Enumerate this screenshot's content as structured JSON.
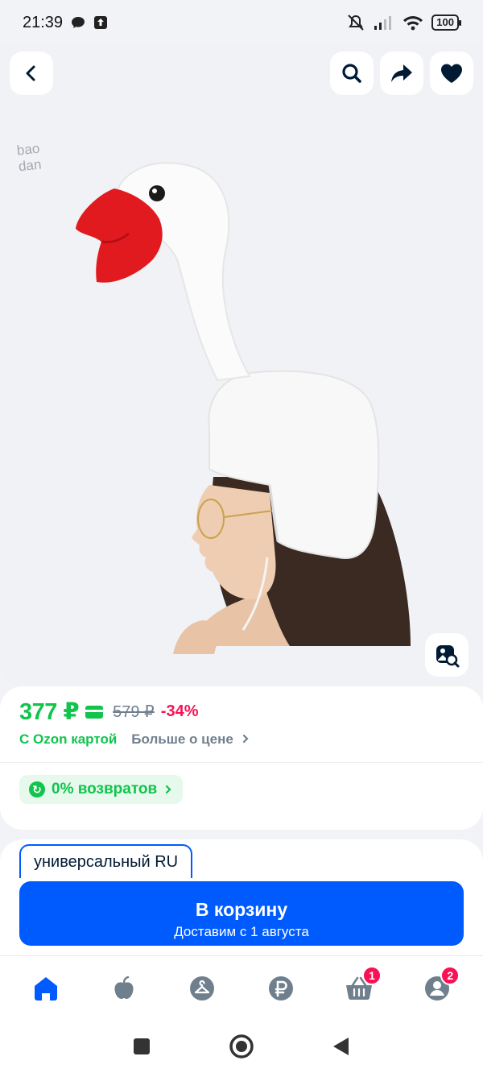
{
  "status": {
    "time": "21:39",
    "battery": "100"
  },
  "hero": {
    "watermark_line1": "bao",
    "watermark_line2": "dan",
    "image_alt": "goose hat"
  },
  "price": {
    "current": "377 ₽",
    "old": "579 ₽",
    "discount": "-34%",
    "ozon_card_label": "С Ozon картой",
    "more_label": "Больше о цене",
    "returns_label": "0% возвратов"
  },
  "variant": {
    "selected": "универсальный RU"
  },
  "cart": {
    "title": "В корзину",
    "subtitle": "Доставим с 1 августа"
  },
  "nav": {
    "cart_badge": "1",
    "profile_badge": "2"
  },
  "colors": {
    "accent": "#005bff",
    "price": "#10c44c",
    "discount": "#f91155"
  }
}
